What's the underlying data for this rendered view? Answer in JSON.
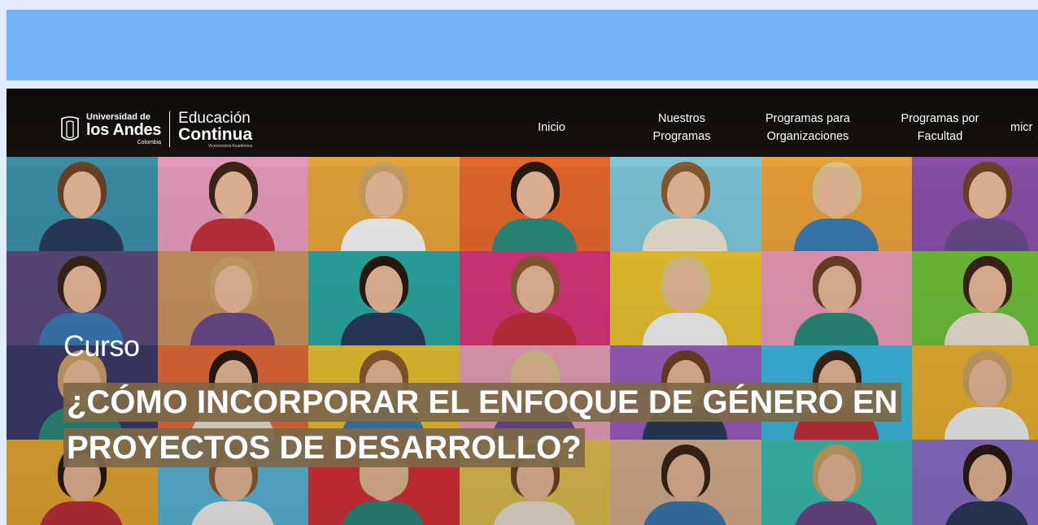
{
  "colors": {
    "top_banner": "#73b3f7",
    "page_background": "#e3ecfb",
    "navbar": "#0e0c0a",
    "title_highlight": "#7d6848"
  },
  "logo": {
    "university_top": "Universidad de",
    "university_main": "los Andes",
    "university_sub": "Colombia",
    "brand_top": "Educación",
    "brand_main": "Continua",
    "brand_sub": "Vicerrectoría Académica",
    "emblem_icon": "andes-emblem-icon"
  },
  "nav": {
    "items": [
      {
        "label": "Inicio"
      },
      {
        "label": "Nuestros\nProgramas"
      },
      {
        "label": "Programas para\nOrganizaciones"
      },
      {
        "label": "Programas por\nFacultad"
      },
      {
        "label": "micr"
      }
    ]
  },
  "hero": {
    "kicker": "Curso",
    "title": "¿CÓMO INCORPORAR EL ENFOQUE DE GÉNERO EN PROYECTOS DE DESARROLLO?",
    "tile_colors": [
      [
        "#3a8fa6",
        "#e59ab9",
        "#e2a43a",
        "#e4672c",
        "#7cc6d6",
        "#e8a03a",
        "#8a4fa8"
      ],
      [
        "#5a4a7a",
        "#c9935f",
        "#2aa6a0",
        "#d8357a",
        "#e8c22e",
        "#e89ab7",
        "#6cc03a"
      ],
      [
        "#3a3a6a",
        "#e26a3a",
        "#e8c030",
        "#e6a0b8",
        "#9a5fc0",
        "#3ab8e0",
        "#e8b030"
      ],
      [
        "#e8a830",
        "#5ab8d8",
        "#d8303a",
        "#e0c050",
        "#d8b090",
        "#3ac0b0",
        "#8a70c8"
      ]
    ]
  }
}
